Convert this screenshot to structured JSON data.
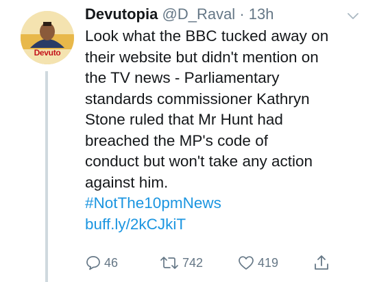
{
  "tweet": {
    "display_name": "Devutopia",
    "handle": "@D_Raval",
    "separator": "·",
    "time": "13h",
    "avatar_caption": "Devuto",
    "body_lines": [
      "Look what the BBC tucked away on",
      "their website but didn't mention on",
      "the TV news - Parliamentary",
      "standards commissioner Kathryn",
      "Stone ruled that Mr Hunt had",
      "breached the MP's code of",
      "conduct but won't take any action",
      "against him."
    ],
    "hashtag": "#NotThe10pmNews",
    "link": "buff.ly/2kCJkiT",
    "reply_count": "46",
    "retweet_count": "742",
    "like_count": "419"
  },
  "icons": {
    "menu": "chevron-down-icon",
    "reply": "reply-icon",
    "retweet": "retweet-icon",
    "like": "heart-icon",
    "share": "share-icon"
  },
  "colors": {
    "link": "#1b95e0",
    "secondary_text": "#657786",
    "primary_text": "#14171a",
    "thread_line": "#cfd9de"
  }
}
